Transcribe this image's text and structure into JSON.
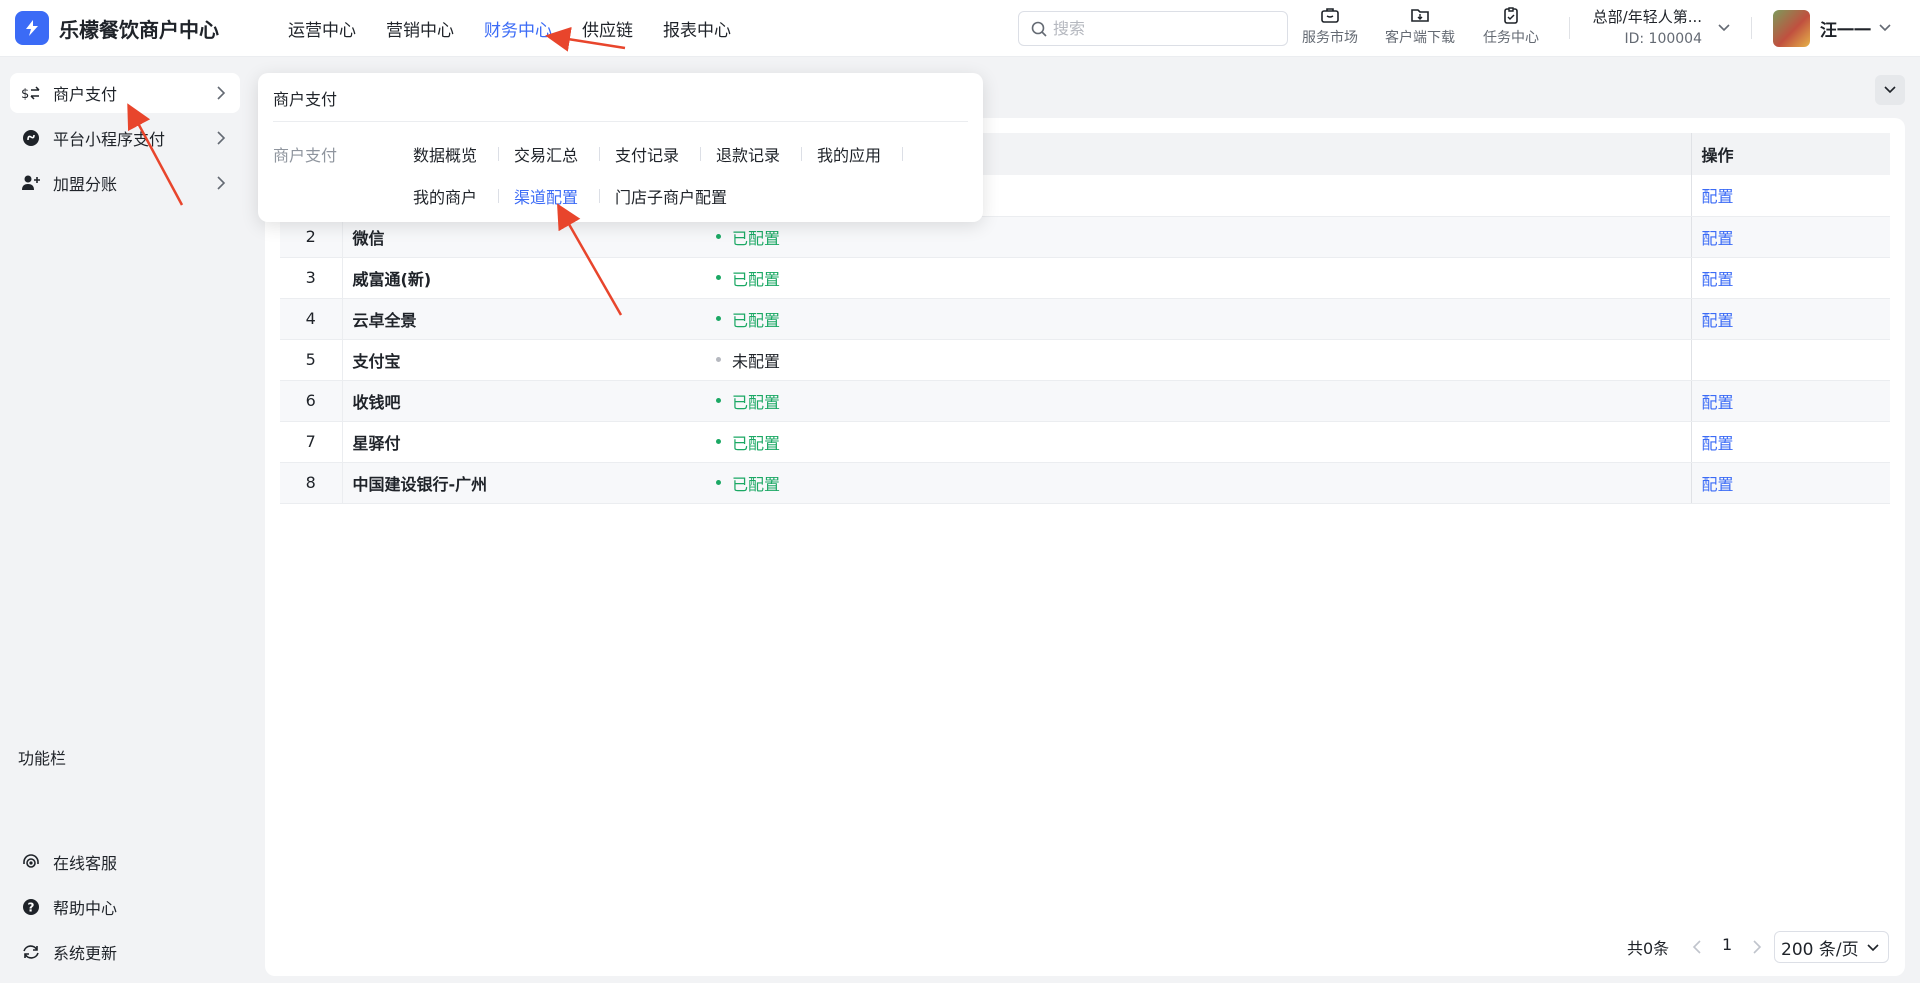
{
  "app": {
    "title": "乐檬餐饮商户中心",
    "brand_color": "#3b6bf6"
  },
  "nav": [
    {
      "label": "运营中心",
      "active": false
    },
    {
      "label": "营销中心",
      "active": false
    },
    {
      "label": "财务中心",
      "active": true
    },
    {
      "label": "供应链",
      "active": false
    },
    {
      "label": "报表中心",
      "active": false
    }
  ],
  "search": {
    "placeholder": "搜索"
  },
  "tools": [
    {
      "label": "服务市场",
      "icon": "briefcase-icon"
    },
    {
      "label": "客户端下载",
      "icon": "download-folder-icon"
    },
    {
      "label": "任务中心",
      "icon": "task-clipboard-icon"
    }
  ],
  "org": {
    "name": "总部/年轻人第...",
    "id": "ID: 100004"
  },
  "user": {
    "name": "汪一一"
  },
  "sidebar": {
    "items": [
      {
        "label": "商户支付",
        "icon": "dollar-exchange-icon",
        "active": true
      },
      {
        "label": "平台小程序支付",
        "icon": "mini-program-icon",
        "active": false
      },
      {
        "label": "加盟分账",
        "icon": "user-add-icon",
        "active": false
      }
    ],
    "function_title": "功能栏",
    "bottom": [
      {
        "label": "在线客服",
        "icon": "headset-icon"
      },
      {
        "label": "帮助中心",
        "icon": "help-circle-icon"
      },
      {
        "label": "系统更新",
        "icon": "refresh-icon"
      }
    ]
  },
  "dropdown": {
    "title": "商户支付",
    "group": "商户支付",
    "links": [
      {
        "label": "数据概览",
        "active": false
      },
      {
        "label": "交易汇总",
        "active": false
      },
      {
        "label": "支付记录",
        "active": false
      },
      {
        "label": "退款记录",
        "active": false
      },
      {
        "label": "我的应用",
        "active": false
      },
      {
        "label": "我的商户",
        "active": false
      },
      {
        "label": "渠道配置",
        "active": true
      },
      {
        "label": "门店子商户配置",
        "active": false
      }
    ]
  },
  "table": {
    "op_header": "操作",
    "rows": [
      {
        "index": "2",
        "name": "微信",
        "status": "已配置",
        "configured": true,
        "action": "配置"
      },
      {
        "index": "3",
        "name": "威富通(新)",
        "status": "已配置",
        "configured": true,
        "action": "配置"
      },
      {
        "index": "4",
        "name": "云卓全景",
        "status": "已配置",
        "configured": true,
        "action": "配置"
      },
      {
        "index": "5",
        "name": "支付宝",
        "status": "未配置",
        "configured": false,
        "action": ""
      },
      {
        "index": "6",
        "name": "收钱吧",
        "status": "已配置",
        "configured": true,
        "action": "配置"
      },
      {
        "index": "7",
        "name": "星驿付",
        "status": "已配置",
        "configured": true,
        "action": "配置"
      },
      {
        "index": "8",
        "name": "中国建设银行-广州",
        "status": "已配置",
        "configured": true,
        "action": "配置"
      }
    ],
    "first_row_action": "配置"
  },
  "pagination": {
    "total": "共0条",
    "current_page": "1",
    "page_size": "200 条/页"
  }
}
